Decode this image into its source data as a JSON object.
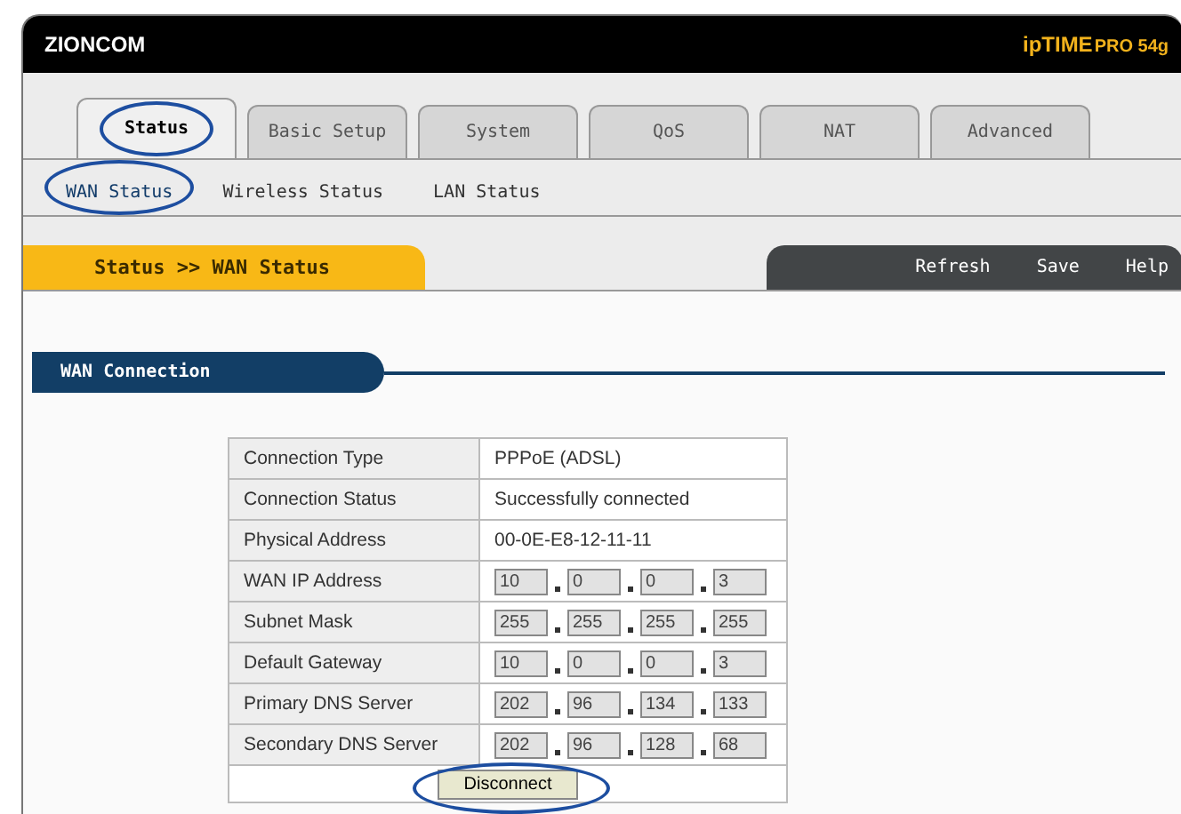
{
  "header": {
    "brand": "ZIONCOM",
    "product": "ipTIME",
    "model": "PRO 54g"
  },
  "tabs": [
    {
      "label": "Status",
      "selected": true,
      "circled": true
    },
    {
      "label": "Basic Setup",
      "selected": false,
      "circled": false
    },
    {
      "label": "System",
      "selected": false,
      "circled": false
    },
    {
      "label": "QoS",
      "selected": false,
      "circled": false
    },
    {
      "label": "NAT",
      "selected": false,
      "circled": false
    },
    {
      "label": "Advanced",
      "selected": false,
      "circled": false
    }
  ],
  "subtabs": [
    {
      "label": "WAN Status",
      "selected": true,
      "circled": true
    },
    {
      "label": "Wireless Status",
      "selected": false,
      "circled": false
    },
    {
      "label": "LAN Status",
      "selected": false,
      "circled": false
    }
  ],
  "breadcrumb": "Status >> WAN Status",
  "actions": [
    "Refresh",
    "Save",
    "Help"
  ],
  "section": {
    "title": "WAN Connection"
  },
  "rows": [
    {
      "kind": "text",
      "label": "Connection Type",
      "value": "PPPoE (ADSL)"
    },
    {
      "kind": "text",
      "label": "Connection Status",
      "value": "Successfully connected"
    },
    {
      "kind": "text",
      "label": "Physical Address",
      "value": "00-0E-E8-12-11-11"
    },
    {
      "kind": "ip",
      "label": "WAN IP Address",
      "octets": [
        "10",
        "0",
        "0",
        "3"
      ]
    },
    {
      "kind": "ip",
      "label": "Subnet Mask",
      "octets": [
        "255",
        "255",
        "255",
        "255"
      ]
    },
    {
      "kind": "ip",
      "label": "Default Gateway",
      "octets": [
        "10",
        "0",
        "0",
        "3"
      ]
    },
    {
      "kind": "ip",
      "label": "Primary DNS Server",
      "octets": [
        "202",
        "96",
        "134",
        "133"
      ]
    },
    {
      "kind": "ip",
      "label": "Secondary DNS Server",
      "octets": [
        "202",
        "96",
        "128",
        "68"
      ]
    }
  ],
  "button": {
    "label": "Disconnect",
    "circled": true
  }
}
